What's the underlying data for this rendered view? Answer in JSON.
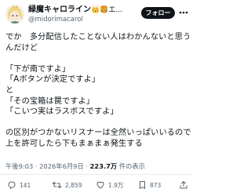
{
  "header": {
    "display_name": "緑魔キャロライン",
    "name_emoji": "👑🍔エ...",
    "handle": "@midorimacarol",
    "follow_label": "フォロー"
  },
  "body": {
    "lines": [
      "でか　多分配信したことない人はわかんないと思う",
      "んだけど",
      "",
      "「下が南ですよ」",
      "「Aボタンが決定ですよ」",
      "と",
      "「その宝箱は罠ですよ」",
      "「こいつ実はラスボスですよ」",
      "",
      "の区別がつかないリスナーは全然いっぱいいるので",
      "上を許可したら下もまぁまぁ発生する"
    ]
  },
  "meta": {
    "time": "午後9:03",
    "sep1": " · ",
    "date": "2026年6月9日",
    "sep2": " · ",
    "views": "223.7万",
    "views_label": " 件の表示"
  },
  "actions": {
    "reply_count": "141",
    "retweet_count": "2,859",
    "like_count": "1.9万",
    "bookmark_count": "873"
  },
  "colors": {
    "text": "#0f1419",
    "secondary": "#536471",
    "verified": "#1d9bf0",
    "follow_bg": "#0f1419"
  }
}
